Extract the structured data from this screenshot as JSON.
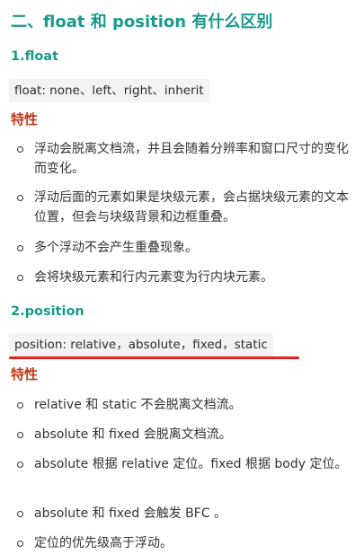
{
  "heading_main": "二、float 和 position 有什么区别",
  "float_section": {
    "title": "1.float",
    "code": "float: none、left、right、inherit",
    "features_title": "特性",
    "items": [
      "浮动会脱离文档流，并且会随着分辨率和窗口尺寸的变化而变化。",
      "浮动后面的元素如果是块级元素，会占据块级元素的文本位置，但会与块级背景和边框重叠。",
      "多个浮动不会产生重叠现象。",
      "会将块级元素和行内元素变为行内块元素。"
    ]
  },
  "position_section": {
    "title": "2.position",
    "code": "position: relative，absolute，fixed，static",
    "features_title": "特性",
    "items": [
      "relative 和 static 不会脱离文档流。",
      "absolute 和 fixed 会脱离文档流。",
      "absolute 根据 relative 定位。fixed 根据 body 定位。",
      "absolute 和 fixed 会触发 BFC 。",
      "定位的优先级高于浮动。"
    ]
  },
  "colors": {
    "heading": "#1a9a8a",
    "features": "#c0391b",
    "underline": "#e8231b",
    "code_bg": "#f3f3f3"
  }
}
